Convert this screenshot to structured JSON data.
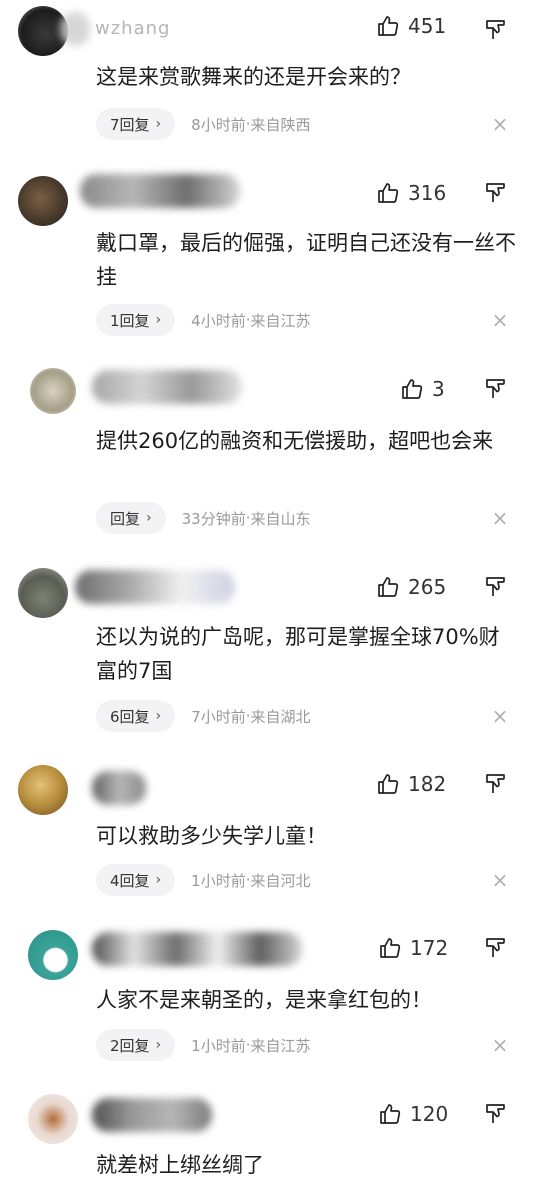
{
  "comments": [
    {
      "username": "wzhang",
      "likes": "451",
      "text": "这是来赏歌舞来的还是开会来的？",
      "reply_label": "7回复",
      "time": "8小时前",
      "location": "来自陕西",
      "avatar_color": "#2a2a2a"
    },
    {
      "username": "",
      "likes": "316",
      "text": "戴口罩，最后的倔强，证明自己还没有一丝不挂",
      "reply_label": "1回复",
      "time": "4小时前",
      "location": "来自江苏",
      "avatar_color": "#5a4632"
    },
    {
      "username": "",
      "likes": "3",
      "text": "提供260亿的融资和无偿援助，超吧也会来",
      "reply_label": "回复",
      "time": "33分钟前",
      "location": "来自山东",
      "avatar_color": "#b9b3a0"
    },
    {
      "username": "",
      "likes": "265",
      "text": "还以为说的广岛呢，那可是掌握全球70%财富的7国",
      "reply_label": "6回复",
      "time": "7小时前",
      "location": "来自湖北",
      "avatar_color": "#6c6f63"
    },
    {
      "username": "",
      "likes": "182",
      "text": "可以救助多少失学儿童！",
      "reply_label": "4回复",
      "time": "1小时前",
      "location": "来自河北",
      "avatar_color": "#c9a55a"
    },
    {
      "username": "",
      "likes": "172",
      "text": "人家不是来朝圣的，是来拿红包的！",
      "reply_label": "2回复",
      "time": "1小时前",
      "location": "来自江苏",
      "avatar_color": "#3aa39a"
    },
    {
      "username": "",
      "likes": "120",
      "text": "就差树上绑丝绸了",
      "avatar_color": "#e8e0dc"
    }
  ],
  "meta_separator": " · "
}
